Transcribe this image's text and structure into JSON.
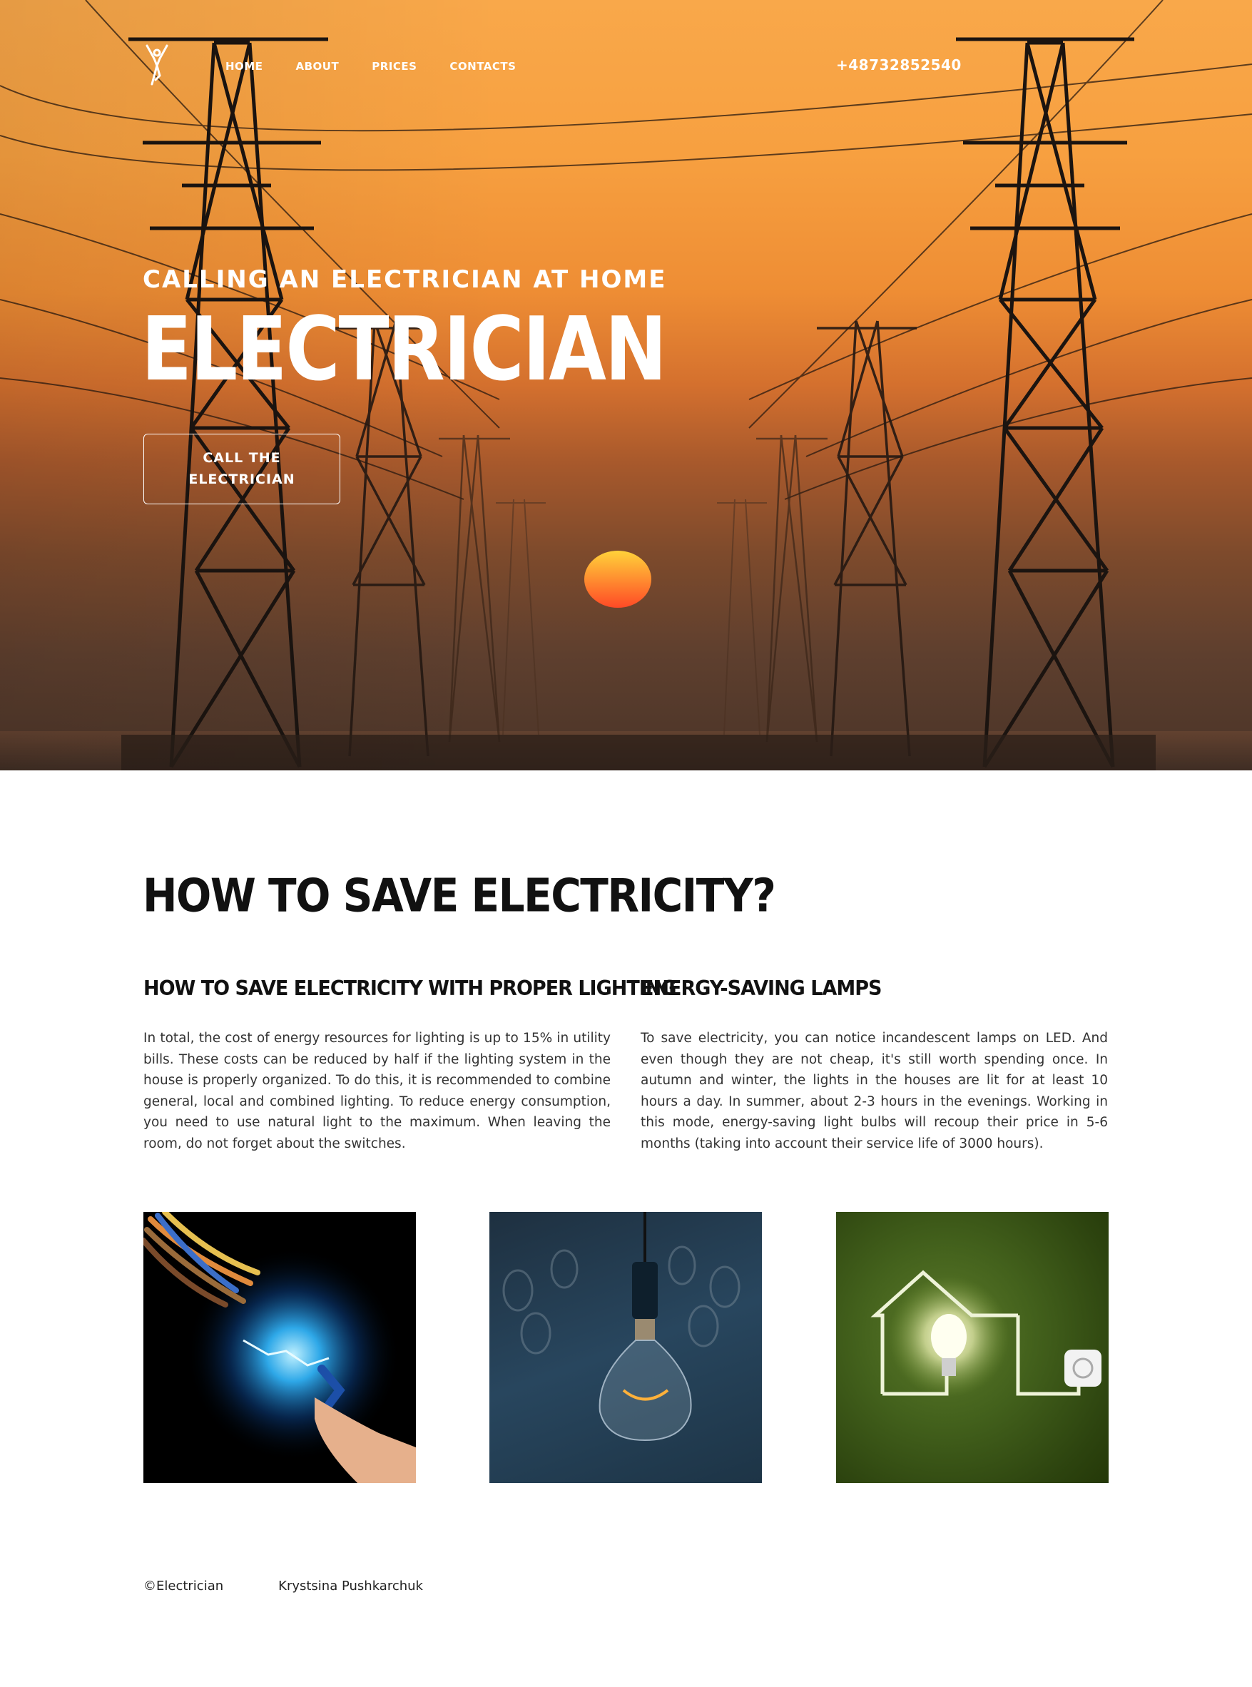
{
  "nav": {
    "links": [
      "HOME",
      "ABOUT",
      "PRICES",
      "CONTACTS"
    ],
    "phone": "+48732852540"
  },
  "hero": {
    "subtitle": "CALLING AN ELECTRICIAN AT HOME",
    "title": "ELECTRICIAN",
    "button_label": "CALL THE ELECTRICIAN"
  },
  "save": {
    "title": "HOW TO SAVE ELECTRICITY?",
    "columns": [
      {
        "heading": "HOW TO SAVE ELECTRICITY WITH PROPER LIGHTING",
        "text": "In total, the cost of energy resources for lighting is up to 15% in utility bills. These costs can be reduced by half if the lighting system in the house is properly organized. To do this, it is recommended to combine general, local and combined lighting. To reduce energy consumption, you need to use natural light to the maximum. When leaving the room, do not forget about the switches."
      },
      {
        "heading": "ENERGY-SAVING LAMPS",
        "text": "To save electricity, you can notice incandescent lamps on LED. And even though they are not cheap, it's still worth spending once. In autumn and winter, the lights in the houses are lit for at least 10 hours a day. In summer, about 2-3 hours in the evenings. Working in this mode, energy-saving light bulbs will recoup their price in 5-6 months (taking into account their service life of 3000 hours)."
      }
    ]
  },
  "footer": {
    "copyright": "©Electrician",
    "author": "Krystsina Pushkarchuk"
  }
}
